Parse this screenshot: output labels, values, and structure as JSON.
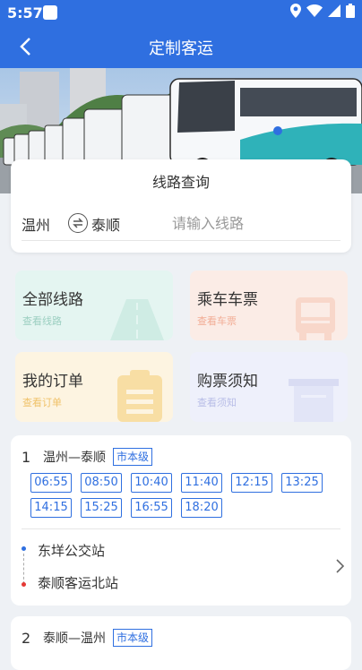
{
  "status_bar": {
    "time": "5:57"
  },
  "app_bar": {
    "title": "定制客运"
  },
  "search": {
    "title": "线路查询",
    "from": "温州",
    "to": "泰顺",
    "placeholder": "请输入线路"
  },
  "tiles": [
    {
      "title": "全部线路",
      "subtitle": "查看线路"
    },
    {
      "title": "乘车车票",
      "subtitle": "查看车票"
    },
    {
      "title": "我的订单",
      "subtitle": "查看订单"
    },
    {
      "title": "购票须知",
      "subtitle": "查看须知"
    }
  ],
  "routes": [
    {
      "num": "1",
      "name": "温州—泰顺",
      "badge": "市本级",
      "times": [
        "06:55",
        "08:50",
        "10:40",
        "11:40",
        "12:15",
        "13:25",
        "14:15",
        "15:25",
        "16:55",
        "18:20"
      ],
      "start_stop": "东垟公交站",
      "end_stop": "泰顺客运北站"
    },
    {
      "num": "2",
      "name": "泰顺—温州",
      "badge": "市本级"
    }
  ],
  "colors": {
    "primary": "#2f6fe0",
    "start_dot": "#2f6fe0",
    "end_dot": "#e53935"
  }
}
